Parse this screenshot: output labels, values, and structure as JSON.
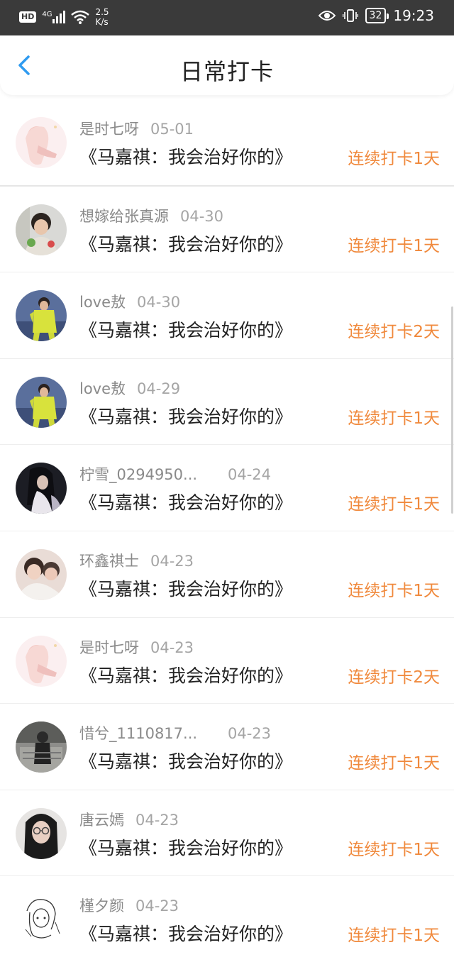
{
  "status_bar": {
    "hd": "HD",
    "network": "4G",
    "speed_value": "2.5",
    "speed_unit": "K/s",
    "battery": "32",
    "time": "19:23"
  },
  "header": {
    "title": "日常打卡",
    "back_icon": "chevron-left-icon"
  },
  "colors": {
    "accent": "#2f9bf0",
    "streak": "#f0893c",
    "status_bar_bg": "#3a3a3a"
  },
  "entries": [
    {
      "name": "是时七呀",
      "date": "05-01",
      "book": "《马嘉祺：我会治好你的》",
      "streak": "连续打卡1天"
    },
    {
      "name": "想嫁给张真源",
      "date": "04-30",
      "book": "《马嘉祺：我会治好你的》",
      "streak": "连续打卡1天"
    },
    {
      "name": "love敖",
      "date": "04-30",
      "book": "《马嘉祺：我会治好你的》",
      "streak": "连续打卡2天"
    },
    {
      "name": "love敖",
      "date": "04-29",
      "book": "《马嘉祺：我会治好你的》",
      "streak": "连续打卡1天"
    },
    {
      "name": "柠雪_0294950...",
      "date": "04-24",
      "book": "《马嘉祺：我会治好你的》",
      "streak": "连续打卡1天"
    },
    {
      "name": "环鑫祺士",
      "date": "04-23",
      "book": "《马嘉祺：我会治好你的》",
      "streak": "连续打卡1天"
    },
    {
      "name": "是时七呀",
      "date": "04-23",
      "book": "《马嘉祺：我会治好你的》",
      "streak": "连续打卡2天"
    },
    {
      "name": "惜兮_1110817...",
      "date": "04-23",
      "book": "《马嘉祺：我会治好你的》",
      "streak": "连续打卡1天"
    },
    {
      "name": "唐云嫣",
      "date": "04-23",
      "book": "《马嘉祺：我会治好你的》",
      "streak": "连续打卡1天"
    },
    {
      "name": "槿夕颜",
      "date": "04-23",
      "book": "《马嘉祺：我会治好你的》",
      "streak": "连续打卡1天"
    }
  ]
}
